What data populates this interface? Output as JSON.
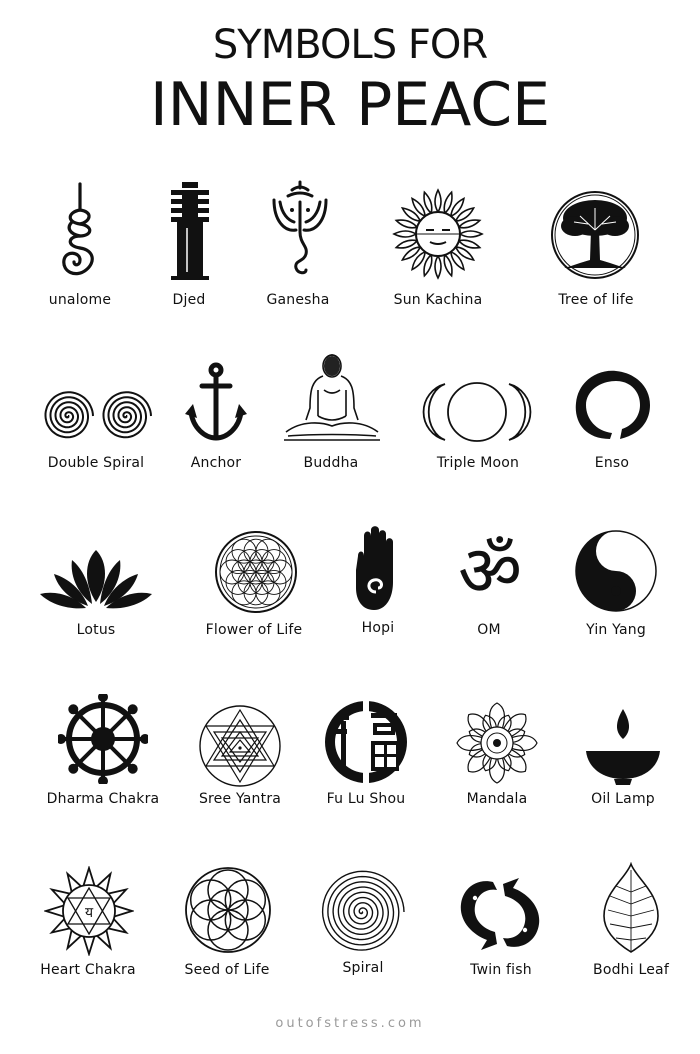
{
  "title": {
    "line1": "SYMBOLS FOR",
    "line2": "INNER PEACE"
  },
  "symbols": [
    {
      "label": "unalome",
      "icon": "unalome-icon"
    },
    {
      "label": "Djed",
      "icon": "djed-icon"
    },
    {
      "label": "Ganesha",
      "icon": "ganesha-icon"
    },
    {
      "label": "Sun Kachina",
      "icon": "sun-kachina-icon"
    },
    {
      "label": "Tree of life",
      "icon": "tree-of-life-icon"
    },
    {
      "label": "Double Spiral",
      "icon": "double-spiral-icon"
    },
    {
      "label": "Anchor",
      "icon": "anchor-icon"
    },
    {
      "label": "Buddha",
      "icon": "buddha-icon"
    },
    {
      "label": "Triple Moon",
      "icon": "triple-moon-icon"
    },
    {
      "label": "Enso",
      "icon": "enso-icon"
    },
    {
      "label": "Lotus",
      "icon": "lotus-icon"
    },
    {
      "label": "Flower of Life",
      "icon": "flower-of-life-icon"
    },
    {
      "label": "Hopi",
      "icon": "hopi-hand-icon"
    },
    {
      "label": "OM",
      "icon": "om-icon"
    },
    {
      "label": "Yin Yang",
      "icon": "yin-yang-icon"
    },
    {
      "label": "Dharma Chakra",
      "icon": "dharma-chakra-icon"
    },
    {
      "label": "Sree Yantra",
      "icon": "sree-yantra-icon"
    },
    {
      "label": "Fu Lu Shou",
      "icon": "fu-lu-shou-icon"
    },
    {
      "label": "Mandala",
      "icon": "mandala-icon"
    },
    {
      "label": "Oil Lamp",
      "icon": "oil-lamp-icon"
    },
    {
      "label": "Heart Chakra",
      "icon": "heart-chakra-icon"
    },
    {
      "label": "Seed of Life",
      "icon": "seed-of-life-icon"
    },
    {
      "label": "Spiral",
      "icon": "spiral-icon"
    },
    {
      "label": "Twin fish",
      "icon": "twin-fish-icon"
    },
    {
      "label": "Bodhi Leaf",
      "icon": "bodhi-leaf-icon"
    }
  ],
  "footer": "outofstress.com"
}
